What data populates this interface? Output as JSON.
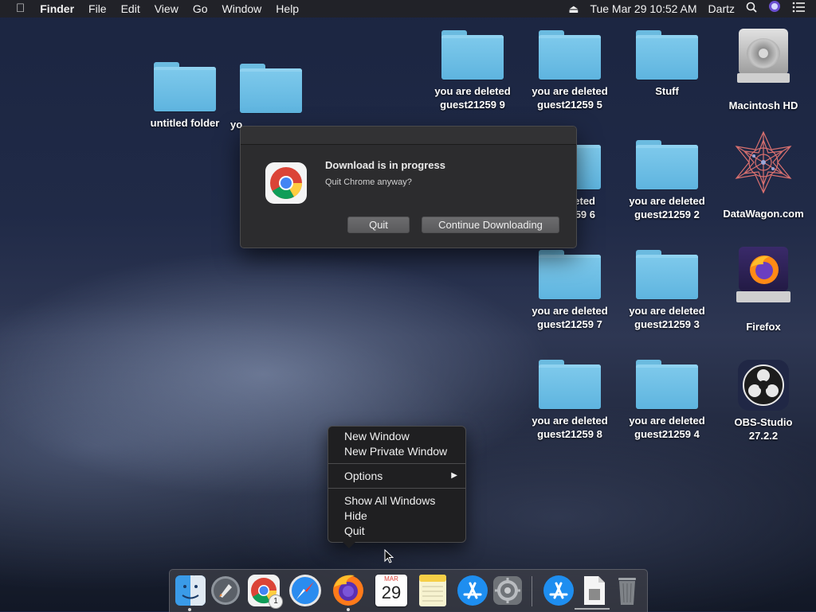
{
  "menubar": {
    "apple": "",
    "app_name": "Finder",
    "menus": [
      "File",
      "Edit",
      "View",
      "Go",
      "Window",
      "Help"
    ],
    "eject_icon": "eject-icon",
    "datetime": "Tue Mar 29  10:52 AM",
    "user": "Dartz"
  },
  "desktop": {
    "folders": [
      {
        "label": "untitled folder"
      },
      {
        "label": "yo"
      },
      {
        "label_line1": "you are deleted",
        "label_line2": "guest21259 9"
      },
      {
        "label_line1": "you are deleted",
        "label_line2": "guest21259 5"
      },
      {
        "label": "Stuff"
      },
      {
        "label_line1": "eleted",
        "label_line2": "59 6"
      },
      {
        "label_line1": "you are deleted",
        "label_line2": "guest21259 2"
      },
      {
        "label_line1": "you are deleted",
        "label_line2": "guest21259 7"
      },
      {
        "label_line1": "you are deleted",
        "label_line2": "guest21259 3"
      },
      {
        "label_line1": "you are deleted",
        "label_line2": "guest21259 8"
      },
      {
        "label_line1": "you are deleted",
        "label_line2": "guest21259 4"
      }
    ],
    "apps": [
      {
        "label": "Macintosh HD"
      },
      {
        "label": "DataWagon.com"
      },
      {
        "label": "Firefox"
      },
      {
        "label_line1": "OBS-Studio",
        "label_line2": "27.2.2"
      }
    ]
  },
  "dialog": {
    "title": "Download is in progress",
    "message": "Quit Chrome anyway?",
    "quit_label": "Quit",
    "continue_label": "Continue Downloading"
  },
  "context_menu": {
    "new_window": "New Window",
    "new_private_window": "New Private Window",
    "options": "Options",
    "show_all_windows": "Show All Windows",
    "hide": "Hide",
    "quit": "Quit"
  },
  "dock": {
    "chrome_badge": "1",
    "calendar_month": "MAR",
    "calendar_day": "29"
  }
}
